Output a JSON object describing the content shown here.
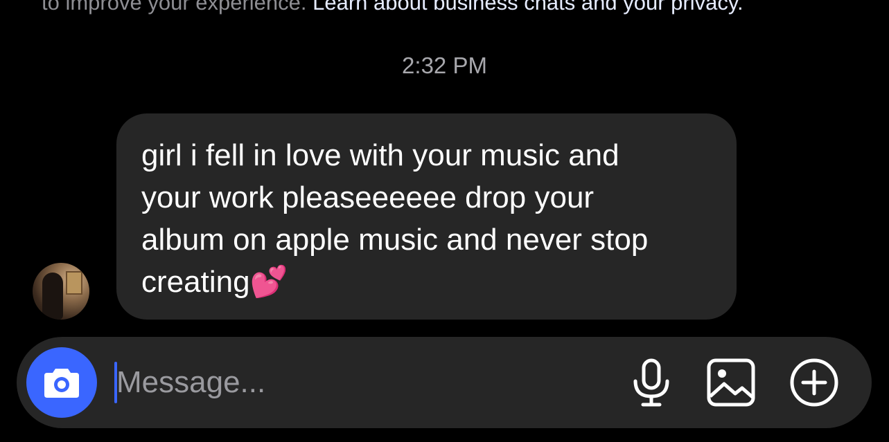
{
  "notice": {
    "prefix": "to improve your experience. ",
    "link": "Learn about business chats and your privacy."
  },
  "timestamp": "2:32 PM",
  "message": {
    "text": "girl i fell in love with your music and\nyour work pleaseeeeee drop your\nalbum on apple music and never stop\ncreating💕"
  },
  "composer": {
    "placeholder": "Message..."
  },
  "icons": {
    "camera": "camera-icon",
    "microphone": "microphone-icon",
    "gallery": "gallery-icon",
    "add": "plus-circle-icon"
  },
  "colors": {
    "accent": "#3a66ff",
    "bubble": "#262626",
    "background": "#000000"
  }
}
